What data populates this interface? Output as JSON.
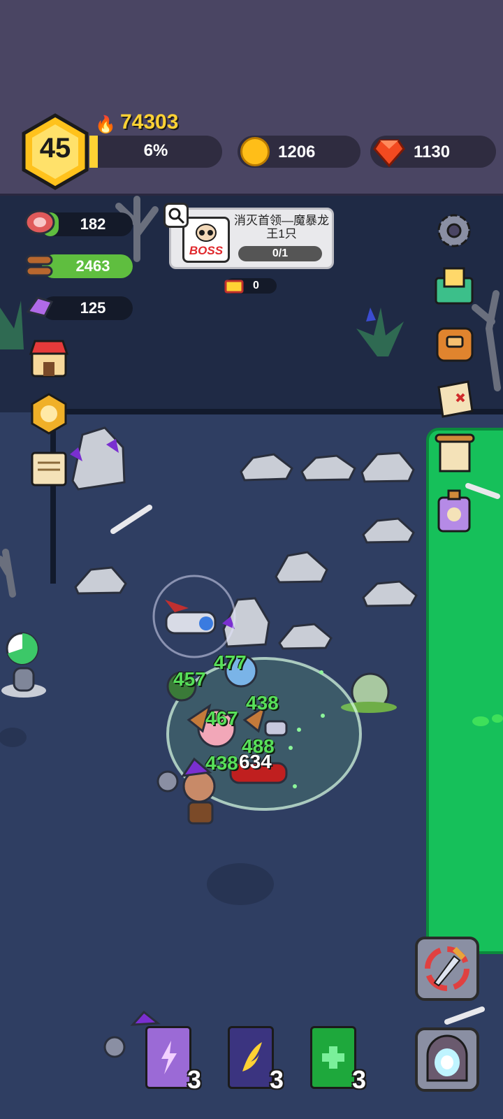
{
  "header": {
    "level": "45",
    "power": "74303",
    "xp_percent_text": "6%",
    "xp_fraction": 0.06,
    "gold": "1206",
    "gems": "1130"
  },
  "resources": {
    "meat": "182",
    "wood": "2463",
    "crystal": "125"
  },
  "quest": {
    "boss_label": "BOSS",
    "title": "消灭首领—魔暴龙王1只",
    "progress": "0/1"
  },
  "chest_count": "0",
  "damage_numbers": [
    "477",
    "457",
    "438",
    "467",
    "488",
    "438",
    "634"
  ],
  "skills": {
    "lightning_book_count": "3",
    "wing_book_count": "3",
    "heal_book_count": "3"
  },
  "colors": {
    "topbar": "#4a4563",
    "accent_gold": "#ffd234",
    "poison_green": "#16c05a",
    "damage_green": "#58e05a"
  },
  "icons": [
    "fire-icon",
    "coin-icon",
    "gem-icon",
    "meat-icon",
    "wood-icon",
    "crystal-icon",
    "shop-icon",
    "medal-icon",
    "scroll-icon",
    "settings-icon",
    "mail-icon",
    "backpack-icon",
    "map-icon",
    "quest-scroll-icon",
    "potion-icon",
    "sword-swap-icon",
    "portal-icon",
    "magnifier-icon",
    "chest-icon"
  ]
}
